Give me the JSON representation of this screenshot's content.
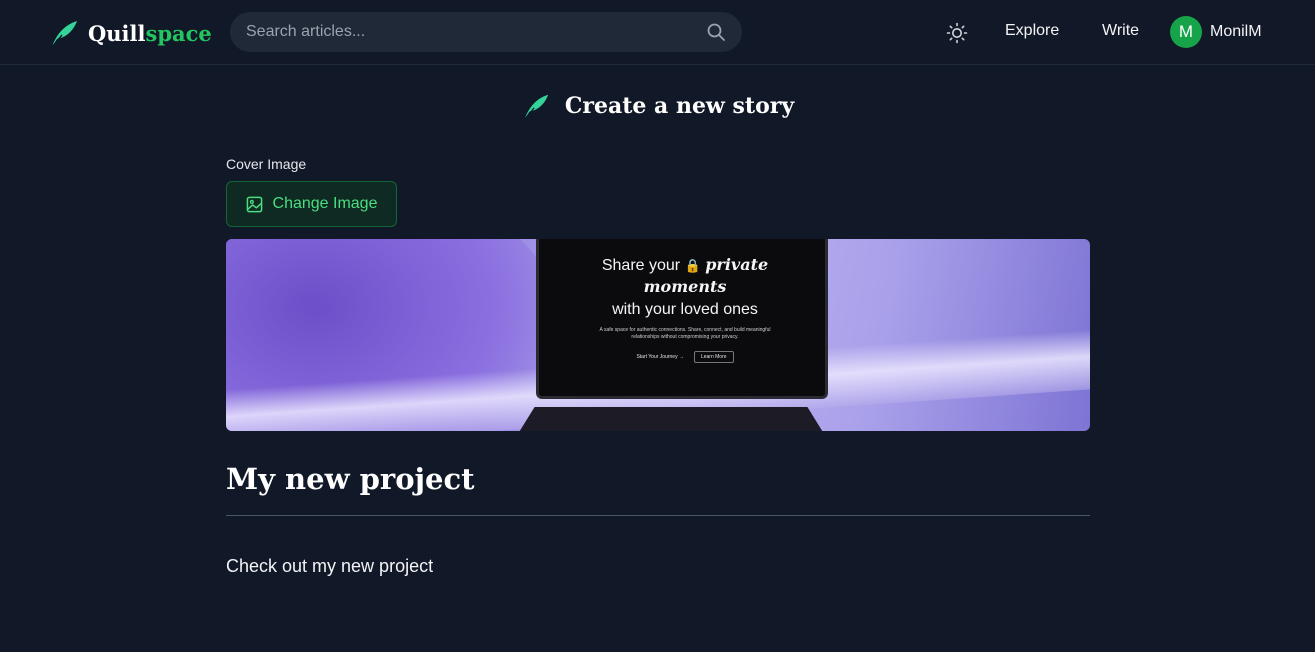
{
  "header": {
    "brand_part1": "Quill",
    "brand_part2": "space",
    "search_placeholder": "Search articles...",
    "nav_explore": "Explore",
    "nav_write": "Write",
    "user_initial": "M",
    "user_name": "MonilM"
  },
  "editor": {
    "page_title": "Create a new story",
    "cover_label": "Cover Image",
    "change_image_label": "Change Image",
    "story_title": "My new project",
    "story_body": "Check out my new project"
  },
  "cover_image": {
    "line1_prefix": "Share your",
    "line1_emph": "private",
    "line2": "moments",
    "line3": "with your loved ones",
    "small_text": "A safe space for authentic connections. Share, connect, and build meaningful relationships without compromising your privacy.",
    "cta_primary": "Start Your Journey →",
    "cta_secondary": "Learn More"
  },
  "colors": {
    "background": "#111827",
    "accent": "#22c55e",
    "avatar": "#16a34a"
  },
  "icons": {
    "logo": "quill-feather-icon",
    "search": "search-icon",
    "theme": "sun-icon",
    "image": "image-icon"
  }
}
